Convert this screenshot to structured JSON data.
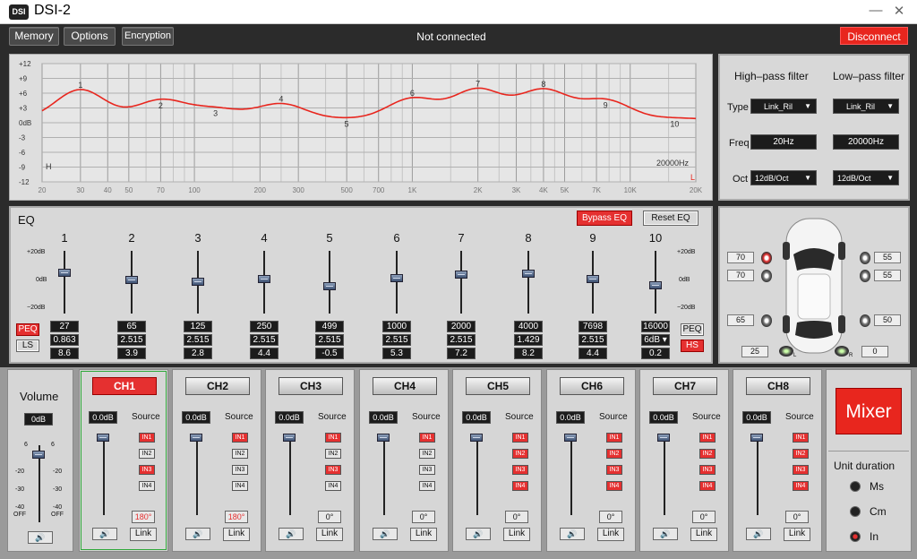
{
  "app": {
    "title": "DSI-2",
    "logo": "DSI",
    "minimize": "—",
    "close": "✕"
  },
  "menu": {
    "memory": "Memory",
    "options": "Options",
    "encryption": "Encryption",
    "status": "Not connected",
    "disconnect": "Disconnect"
  },
  "graph": {
    "y_labels": [
      "+12",
      "+9",
      "+6",
      "+3",
      "0dB",
      "-3",
      "-6",
      "-9",
      "-12"
    ],
    "x_labels": [
      "20",
      "30",
      "40",
      "50",
      "70",
      "100",
      "200",
      "300",
      "500",
      "700",
      "1K",
      "2K",
      "3K",
      "4K",
      "5K",
      "7K",
      "10K",
      "20K"
    ],
    "hp_marker": "H",
    "lp_marker": "L",
    "lp_freq_label": "20000Hz",
    "points": [
      {
        "n": "1",
        "f": 30,
        "db": 8.5
      },
      {
        "n": "2",
        "f": 70,
        "db": 5.5
      },
      {
        "n": "3",
        "f": 125,
        "db": 3
      },
      {
        "n": "4",
        "f": 250,
        "db": 4.5
      },
      {
        "n": "5",
        "f": 499,
        "db": 0.3
      },
      {
        "n": "6",
        "f": 1000,
        "db": 6
      },
      {
        "n": "7",
        "f": 2000,
        "db": 8.5
      },
      {
        "n": "8",
        "f": 4000,
        "db": 8.3
      },
      {
        "n": "9",
        "f": 7698,
        "db": 5.5
      },
      {
        "n": "10",
        "f": 16000,
        "db": 0.5
      }
    ],
    "line_color": "#e8261e"
  },
  "filters": {
    "hp_title": "High–pass filter",
    "lp_title": "Low–pass filter",
    "type_label": "Type",
    "freq_label": "Freq",
    "oct_label": "Oct",
    "hp_type": "Link_Ril",
    "lp_type": "Link_Ril",
    "hp_freq": "20Hz",
    "lp_freq": "20000Hz",
    "hp_oct": "12dB/Oct",
    "lp_oct": "12dB/Oct"
  },
  "eq": {
    "title": "EQ",
    "bypass": "Bypass EQ",
    "reset": "Reset EQ",
    "scale_top": "+20dB",
    "scale_mid": "0dB",
    "scale_bot": "−20dB",
    "peq": "PEQ",
    "ls": "LS",
    "hs": "HS",
    "bands": [
      {
        "n": "1",
        "freq": "27",
        "q": "0.863",
        "gain": "8.6",
        "g": 8.6
      },
      {
        "n": "2",
        "freq": "65",
        "q": "2.515",
        "gain": "3.9",
        "g": 3.9
      },
      {
        "n": "3",
        "freq": "125",
        "q": "2.515",
        "gain": "2.8",
        "g": 2.8
      },
      {
        "n": "4",
        "freq": "250",
        "q": "2.515",
        "gain": "4.4",
        "g": 4.4
      },
      {
        "n": "5",
        "freq": "499",
        "q": "2.515",
        "gain": "-0.5",
        "g": -0.5
      },
      {
        "n": "6",
        "freq": "1000",
        "q": "2.515",
        "gain": "5.3",
        "g": 5.3
      },
      {
        "n": "7",
        "freq": "2000",
        "q": "2.515",
        "gain": "7.2",
        "g": 7.2
      },
      {
        "n": "8",
        "freq": "4000",
        "q": "1.429",
        "gain": "8.2",
        "g": 8.2
      },
      {
        "n": "9",
        "freq": "7698",
        "q": "2.515",
        "gain": "4.4",
        "g": 4.4
      },
      {
        "n": "10",
        "freq": "16000",
        "q": "6dB ▾",
        "gain": "0.2",
        "g": 0.2
      }
    ]
  },
  "car": {
    "fl1": "70",
    "fl2": "70",
    "fr1": "55",
    "fr2": "55",
    "rl": "65",
    "rr": "50",
    "sub_l": "25",
    "sub_r": "0",
    "sub_l_tag": "L",
    "sub_r_tag": "R"
  },
  "volume": {
    "title": "Volume",
    "value": "0dB",
    "scale": [
      "6",
      "-20",
      "-30",
      "-40",
      "OFF"
    ],
    "scale_r": [
      "6",
      "-20",
      "-30",
      "-40",
      "OFF"
    ],
    "mute_icon": "🔊"
  },
  "channels": [
    {
      "name": "CH1",
      "gain": "0.0dB",
      "source": "Source",
      "in": [
        true,
        false,
        true,
        false
      ],
      "phase": "180°",
      "link": "Link",
      "active": true
    },
    {
      "name": "CH2",
      "gain": "0.0dB",
      "source": "Source",
      "in": [
        true,
        false,
        false,
        false
      ],
      "phase": "180°",
      "link": "Link",
      "active": false
    },
    {
      "name": "CH3",
      "gain": "0.0dB",
      "source": "Source",
      "in": [
        true,
        false,
        true,
        false
      ],
      "phase": "0°",
      "link": "Link",
      "active": false
    },
    {
      "name": "CH4",
      "gain": "0.0dB",
      "source": "Source",
      "in": [
        true,
        false,
        false,
        false
      ],
      "phase": "0°",
      "link": "Link",
      "active": false
    },
    {
      "name": "CH5",
      "gain": "0.0dB",
      "source": "Source",
      "in": [
        true,
        true,
        true,
        true
      ],
      "phase": "0°",
      "link": "Link",
      "active": false
    },
    {
      "name": "CH6",
      "gain": "0.0dB",
      "source": "Source",
      "in": [
        true,
        true,
        true,
        true
      ],
      "phase": "0°",
      "link": "Link",
      "active": false
    },
    {
      "name": "CH7",
      "gain": "0.0dB",
      "source": "Source",
      "in": [
        true,
        true,
        true,
        true
      ],
      "phase": "0°",
      "link": "Link",
      "active": false
    },
    {
      "name": "CH8",
      "gain": "0.0dB",
      "source": "Source",
      "in": [
        true,
        true,
        true,
        true
      ],
      "phase": "0°",
      "link": "Link",
      "active": false
    }
  ],
  "in_labels": [
    "IN1",
    "IN2",
    "IN3",
    "IN4"
  ],
  "mixer": {
    "label": "Mixer",
    "unit_title": "Unit duration",
    "units": [
      "Ms",
      "Cm",
      "In"
    ],
    "selected": "In"
  }
}
